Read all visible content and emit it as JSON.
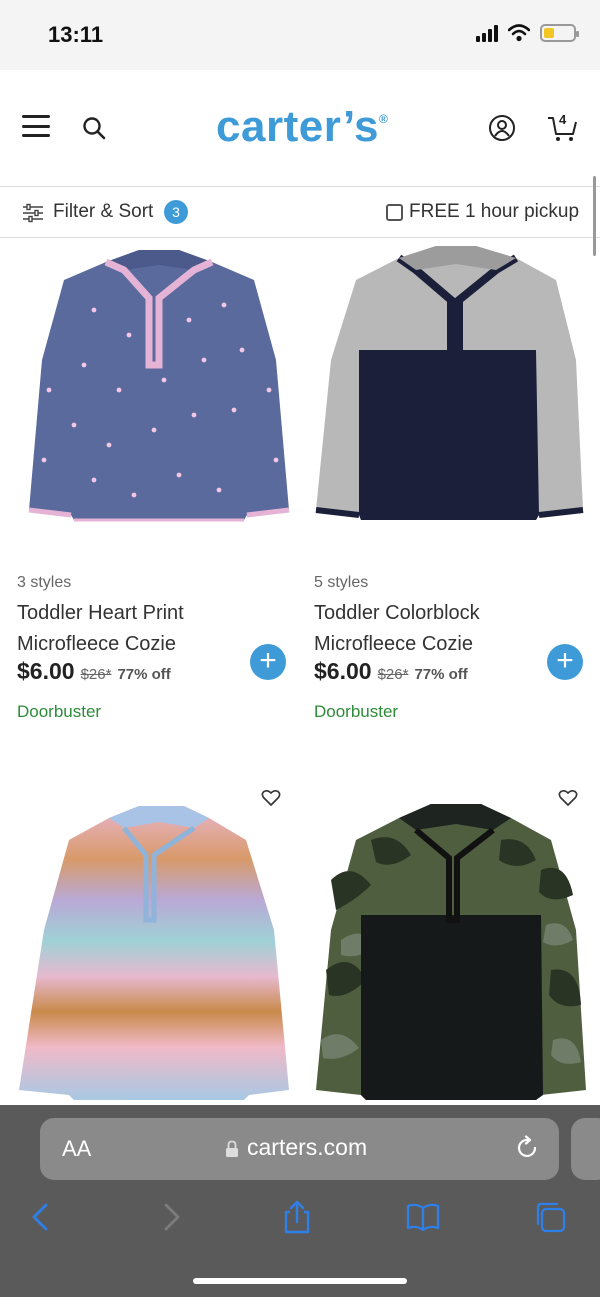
{
  "status_bar": {
    "time": "13:11"
  },
  "header": {
    "logo_text": "carter’s",
    "logo_mark": "®",
    "cart_count": "4"
  },
  "filter_bar": {
    "filter_label": "Filter & Sort",
    "filter_count": "3",
    "pickup_label": "FREE 1 hour pickup"
  },
  "products": [
    {
      "styles": "3 styles",
      "name": "Toddler Heart Print Microfleece Cozie",
      "sale_price": "$6.00",
      "orig_price": "$26*",
      "discount": "77% off",
      "promo": "Doorbuster",
      "image": "navy-heart-print-microfleece"
    },
    {
      "styles": "5 styles",
      "name": "Toddler Colorblock Microfleece Cozie",
      "sale_price": "$6.00",
      "orig_price": "$26*",
      "discount": "77% off",
      "promo": "Doorbuster",
      "image": "gray-navy-colorblock-microfleece"
    },
    {
      "image": "rainbow-stripe-microfleece"
    },
    {
      "image": "green-camo-microfleece"
    }
  ],
  "browser": {
    "text_size_label": "AA",
    "url": "carters.com"
  },
  "colors": {
    "brand_blue": "#3e9bd8",
    "promo_green": "#2e8b3a"
  }
}
